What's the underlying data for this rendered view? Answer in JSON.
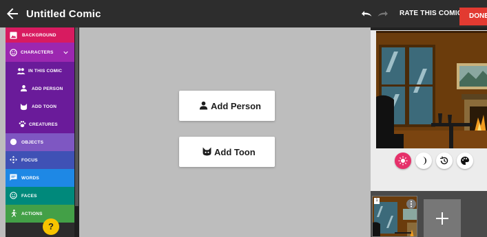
{
  "header": {
    "title": "Untitled Comic",
    "rate_label": "RATE THIS COMIC",
    "done_label": "DONE"
  },
  "sidebar": {
    "items": [
      {
        "id": "background",
        "label": "BACKGROUND",
        "icon": "image-icon",
        "color": "#d81b60"
      },
      {
        "id": "characters",
        "label": "CHARACTERS",
        "icon": "smiley-icon",
        "color": "#9c27b0"
      },
      {
        "id": "in-this-comic",
        "label": "IN THIS COMIC",
        "icon": "people-icon",
        "color": "#6a1b9a"
      },
      {
        "id": "add-person",
        "label": "ADD PERSON",
        "icon": "person-icon",
        "color": "#6a1b9a"
      },
      {
        "id": "add-toon",
        "label": "ADD TOON",
        "icon": "cat-icon",
        "color": "#6a1b9a"
      },
      {
        "id": "creatures",
        "label": "CREATURES",
        "icon": "paw-icon",
        "color": "#6a1b9a"
      },
      {
        "id": "objects",
        "label": "OBJECTS",
        "icon": "circle-icon",
        "color": "#7e57c2"
      },
      {
        "id": "focus",
        "label": "FOCUS",
        "icon": "move-icon",
        "color": "#3f51b5"
      },
      {
        "id": "words",
        "label": "WORDS",
        "icon": "speech-bubble-icon",
        "color": "#1e88e5"
      },
      {
        "id": "faces",
        "label": "FACES",
        "icon": "face-icon",
        "color": "#00897b"
      },
      {
        "id": "actions",
        "label": "ACTIONS",
        "icon": "running-icon",
        "color": "#43a047"
      }
    ],
    "help_label": "?"
  },
  "main": {
    "add_person_label": "Add Person",
    "add_toon_label": "Add Toon"
  },
  "panel": {
    "thumbnail_number": "1"
  },
  "colors": {
    "topbar": "#2d2d2d",
    "done": "#e23a31",
    "canvas": "#bdbdbd",
    "light_mode_active": "#e6306a"
  }
}
